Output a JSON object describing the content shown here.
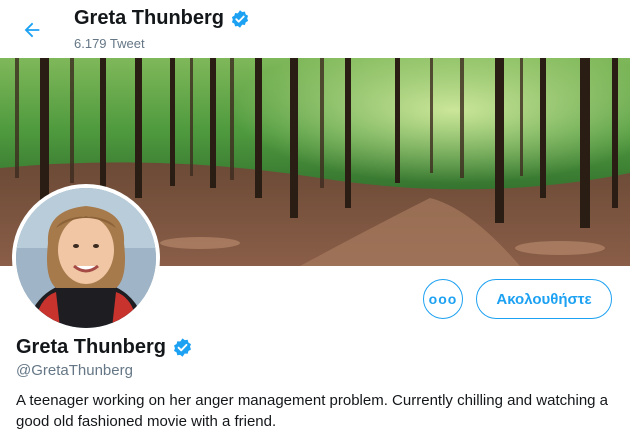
{
  "header": {
    "name": "Greta Thunberg",
    "tweet_count": "6.179 Tweet"
  },
  "profile": {
    "name": "Greta Thunberg",
    "handle": "@GretaThunberg",
    "bio": "A teenager working on her anger management problem. Currently chilling and watching a good old fashioned movie with a friend."
  },
  "actions": {
    "more_label": "ooo",
    "follow_label": "Ακολουθήστε"
  },
  "colors": {
    "accent": "#1da1f2",
    "secondary_text": "#657786"
  },
  "icons": {
    "back": "arrow-left-icon",
    "verified": "verified-badge-icon",
    "more": "more-options-icon"
  }
}
